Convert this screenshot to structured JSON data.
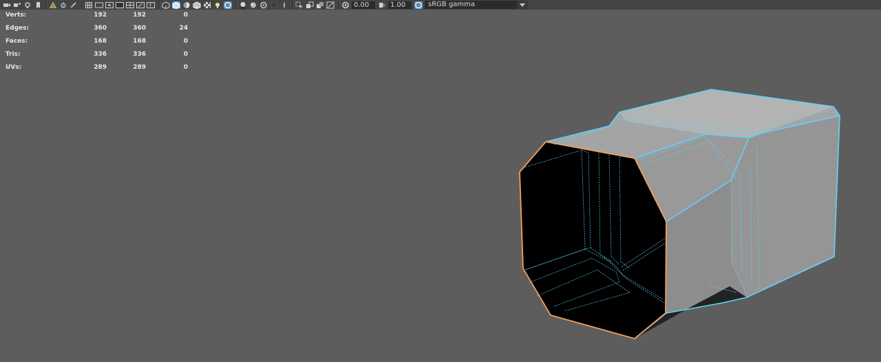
{
  "toolbar": {
    "icons": [
      "camera-icon",
      "camera-attributes-icon",
      "bookmark-icon",
      "bookmark-flag-icon",
      "image-plane-icon",
      "2d-pan-icon",
      "grease-pencil-icon",
      "grid-icon",
      "film-gate-icon",
      "resolution-gate-icon",
      "gate-mask-icon",
      "field-chart-icon",
      "safe-action-icon",
      "safe-title-icon",
      "wireframe-icon",
      "smooth-shade-icon",
      "default-material-icon",
      "shaded-wireframe-icon",
      "textured-icon",
      "lights-icon",
      "xray-icon",
      "shadows-icon",
      "ambient-occlusion-icon",
      "motion-blur-icon",
      "multisample-aa-icon",
      "depth-of-field-icon",
      "isolate-select-icon",
      "xray-joints-icon",
      "xray-active-icon",
      "backface-icon",
      "exposure-icon",
      "gamma-icon",
      "color-management-icon"
    ],
    "exposure_value": "0.00",
    "gamma_value": "1.00",
    "color_space": "sRGB gamma"
  },
  "hud": {
    "rows": [
      {
        "label": "Verts:",
        "c1": "192",
        "c2": "192",
        "c3": "0"
      },
      {
        "label": "Edges:",
        "c1": "360",
        "c2": "360",
        "c3": "24"
      },
      {
        "label": "Faces:",
        "c1": "168",
        "c2": "168",
        "c3": "0"
      },
      {
        "label": "Tris:",
        "c1": "336",
        "c2": "336",
        "c3": "0"
      },
      {
        "label": "UVs:",
        "c1": "289",
        "c2": "289",
        "c3": "0"
      }
    ]
  },
  "colors": {
    "viewport_bg": "#5d5d5d",
    "toolbar_bg": "#444444",
    "active_icon": "#5b8fb9",
    "selection_wire": "#5fd3ff",
    "highlight_edge": "#f0a060"
  }
}
